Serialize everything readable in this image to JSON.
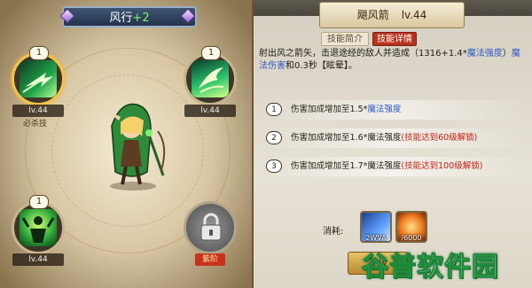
{
  "hero": {
    "name": "风行",
    "star_bonus": "+2"
  },
  "skills": [
    {
      "slot": "top-left",
      "order": "1",
      "level": "lv.44",
      "tag": "必杀技",
      "icon": "green-arrow-icon"
    },
    {
      "slot": "top-right",
      "order": "1",
      "level": "lv.44",
      "icon": "wind-sweep-icon"
    },
    {
      "slot": "bottom-left",
      "order": "1",
      "level": "lv.44",
      "icon": "green-figure-icon"
    },
    {
      "slot": "bottom-right",
      "locked": true,
      "tag": "紫阶",
      "icon": "padlock-icon"
    }
  ],
  "detail": {
    "skill_name": "飓风箭",
    "level": "lv.44",
    "tabs": [
      "技能简介",
      "技能详情"
    ],
    "active_tab": "技能详情",
    "description": {
      "part1": "射出风之箭矢，击退途经的敌人并造成（1316+1.4*",
      "magic_power": "魔法强度",
      "part2": "）",
      "magic_damage": "魔法伤害",
      "part3": "和0.3秒【眩晕】。"
    },
    "upgrades": [
      {
        "num": "1",
        "text": "伤害加成增加至1.5*",
        "stat": "魔法强度",
        "unlock": ""
      },
      {
        "num": "2",
        "text": "伤害加成增加至1.6*魔法强度",
        "stat": "",
        "unlock": "(技能达到60级解锁)"
      },
      {
        "num": "3",
        "text": "伤害加成增加至1.7*魔法强度",
        "stat": "",
        "unlock": "(技能达到100级解锁)"
      }
    ],
    "cost_label": "消耗:",
    "costs": [
      {
        "icon": "blue-scroll-icon",
        "amount": "2WVA"
      },
      {
        "icon": "fire-orb-icon",
        "amount": "/6000"
      }
    ],
    "upgrade_button": "升级"
  },
  "watermark": {
    "text_part1": "谷普",
    "text_part2": "软件园"
  },
  "colors": {
    "accent_red": "#b8321e",
    "magic_blue": "#2d5bc4",
    "unlock_red": "#c21e12"
  }
}
